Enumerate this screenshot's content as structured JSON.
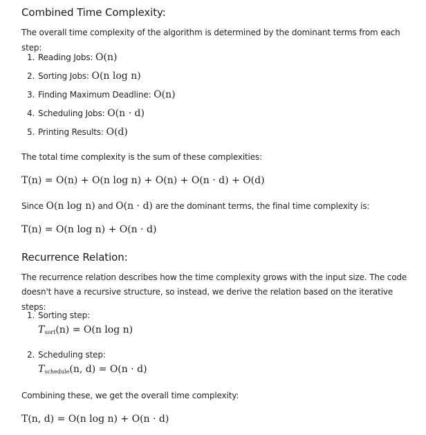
{
  "combined": {
    "heading": "Combined Time Complexity:",
    "intro": "The overall time complexity of the algorithm is determined by the dominant terms from each step:",
    "steps": [
      {
        "num": "1.",
        "label": "Reading Jobs:",
        "expr": "O(n)"
      },
      {
        "num": "2.",
        "label": "Sorting Jobs:",
        "expr": "O(n log n)"
      },
      {
        "num": "3.",
        "label": "Finding Maximum Deadline:",
        "expr": "O(n)"
      },
      {
        "num": "4.",
        "label": "Scheduling Jobs:",
        "expr": "O(n · d)"
      },
      {
        "num": "5.",
        "label": "Printing Results:",
        "expr": "O(d)"
      }
    ],
    "sum_text": "The total time complexity is the sum of these complexities:",
    "sum_eq": "T(n) = O(n) + O(n log n) + O(n) + O(n · d) + O(d)",
    "since_pre": "Since",
    "since_term1": "O(n log n)",
    "since_mid": "and",
    "since_term2": "O(n · d)",
    "since_post": "are the dominant terms, the final time complexity is:",
    "final_eq": "T(n) = O(n log n) + O(n · d)"
  },
  "recurrence": {
    "heading": "Recurrence Relation:",
    "intro_line1": "The recurrence relation describes how the time complexity grows with the input size. The code",
    "intro_line2": "doesn't have a recursive structure, so instead, we derive the relation based on the iterative steps:",
    "items": [
      {
        "num": "1.",
        "label": "Sorting step:",
        "sub": "sort",
        "args": "(n)",
        "rhs": " = O(n log n)"
      },
      {
        "num": "2.",
        "label": "Scheduling step:",
        "sub": "schedule",
        "args": "(n, d)",
        "rhs": " = O(n · d)"
      }
    ],
    "combining_text": "Combining these, we get the overall time complexity:",
    "final_eq": "T(n, d) = O(n log n) + O(n · d)"
  }
}
